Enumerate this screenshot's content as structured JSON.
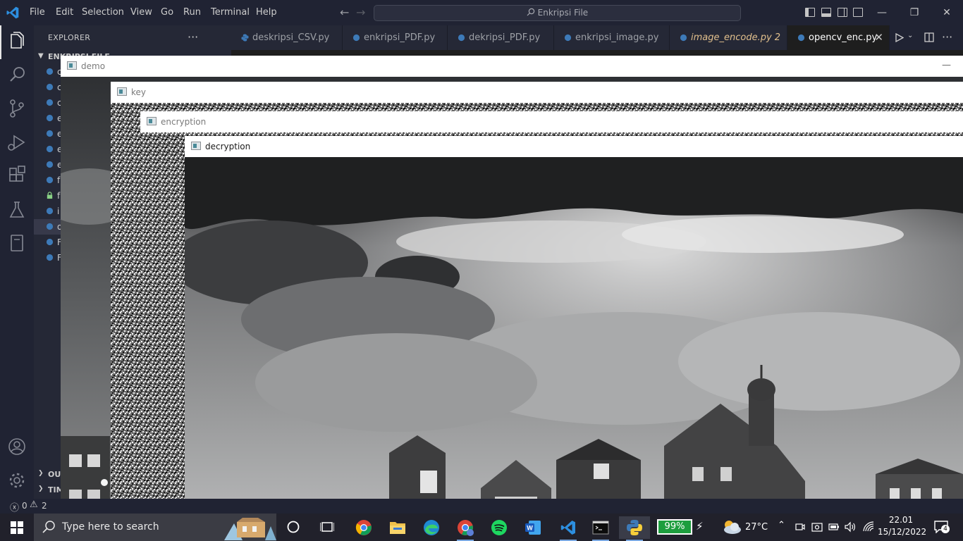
{
  "titlebar": {
    "menu": [
      "File",
      "Edit",
      "Selection",
      "View",
      "Go",
      "Run",
      "Terminal",
      "Help"
    ],
    "search_text": "Enkripsi File"
  },
  "sidebar": {
    "title": "EXPLORER",
    "folder_name": "ENKRIPSI FILE",
    "file_initials": [
      "c",
      "c",
      "c",
      "e",
      "e",
      "e",
      "e",
      "f",
      "f",
      "i",
      "o",
      "F",
      "F"
    ],
    "outline_label": "OUT",
    "timeline_label": "TIM"
  },
  "tabs": [
    {
      "label": "deskripsi_CSV.py",
      "modified": false,
      "active": false
    },
    {
      "label": "enkripsi_PDF.py",
      "modified": false,
      "active": false
    },
    {
      "label": "dekripsi_PDF.py",
      "modified": false,
      "active": false
    },
    {
      "label": "enkripsi_image.py",
      "modified": false,
      "active": false
    },
    {
      "label": "image_encode.py 2",
      "modified": true,
      "active": false
    },
    {
      "label": "opencv_enc.py",
      "modified": false,
      "active": true
    }
  ],
  "windows": {
    "demo": "demo",
    "key": "key",
    "encryption": "encryption",
    "decryption": "decryption"
  },
  "statusbar": {
    "errors": "0",
    "warnings": "2"
  },
  "taskbar": {
    "search_placeholder": "Type here to search",
    "battery": "99%",
    "temperature": "27°C",
    "time": "22.01",
    "date": "15/12/2022",
    "notifications": "4"
  },
  "colors": {
    "vscode_bg": "#202333",
    "accent_python": "#3d7ab8",
    "modified_tab": "#e2c08d",
    "battery_green": "#1d9e3e"
  }
}
